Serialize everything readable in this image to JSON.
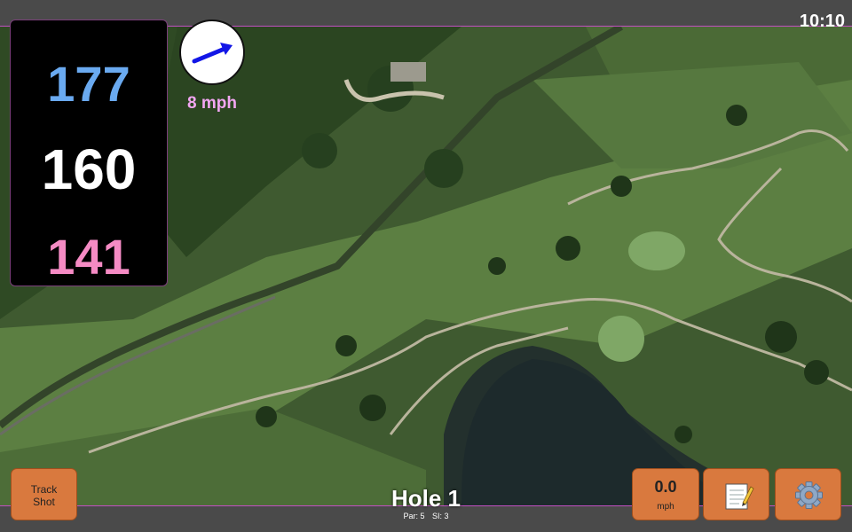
{
  "status": {
    "time": "10:10"
  },
  "distances": {
    "back": "177",
    "middle": "160",
    "front": "141"
  },
  "wind": {
    "speed_label": "8 mph",
    "direction_icon": "wind-arrow-icon"
  },
  "buttons": {
    "track_shot_line1": "Track",
    "track_shot_line2": "Shot",
    "wind_value": "0.0",
    "wind_unit": "mph",
    "notes_icon": "notepad-icon",
    "settings_icon": "gear-icon"
  },
  "hole": {
    "title": "Hole 1",
    "par": "Par: 5",
    "si": "SI: 3"
  },
  "colors": {
    "back": "#6aaaf0",
    "middle": "#ffffff",
    "front": "#f58bc4",
    "accent": "#c24fc2",
    "button": "#d9793e"
  }
}
